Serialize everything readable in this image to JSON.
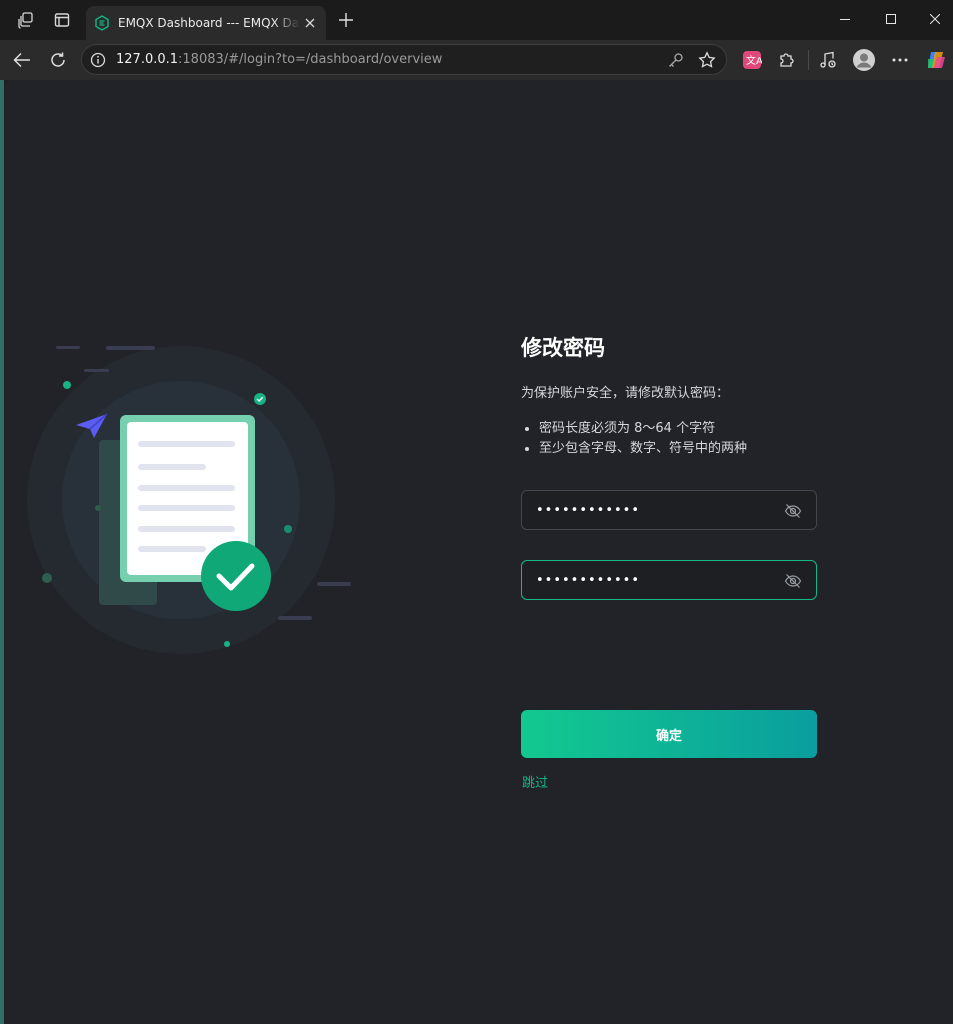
{
  "browser": {
    "tab_title": "EMQX Dashboard --- EMQX Dashboard",
    "url_host": "127.0.0.1",
    "url_rest": ":18083/#/login?to=/dashboard/overview"
  },
  "icons": {
    "workspaces": "workspaces-icon",
    "tab_actions": "tab-actions-icon",
    "back": "back-arrow-icon",
    "refresh": "refresh-icon",
    "info": "site-info-icon",
    "key": "password-key-icon",
    "favorite": "star-icon",
    "translate": "translate-icon",
    "extensions": "puzzle-icon",
    "media": "media-control-icon",
    "profile": "profile-avatar-icon",
    "more": "more-icon",
    "copilot": "copilot-icon"
  },
  "colors": {
    "accent": "#12b886",
    "button_gradient_start": "#12c98f",
    "button_gradient_end": "#0a9e9e",
    "page_bg": "#212328"
  },
  "form": {
    "title": "修改密码",
    "description": "为保护账户安全，请修改默认密码：",
    "rules": [
      "密码长度必须为 8～64 个字符",
      "至少包含字母、数字、符号中的两种"
    ],
    "new_password_value": "••••••••••••",
    "confirm_password_value": "••••••••••••",
    "confirm_label": "确定",
    "skip_label": "跳过"
  }
}
